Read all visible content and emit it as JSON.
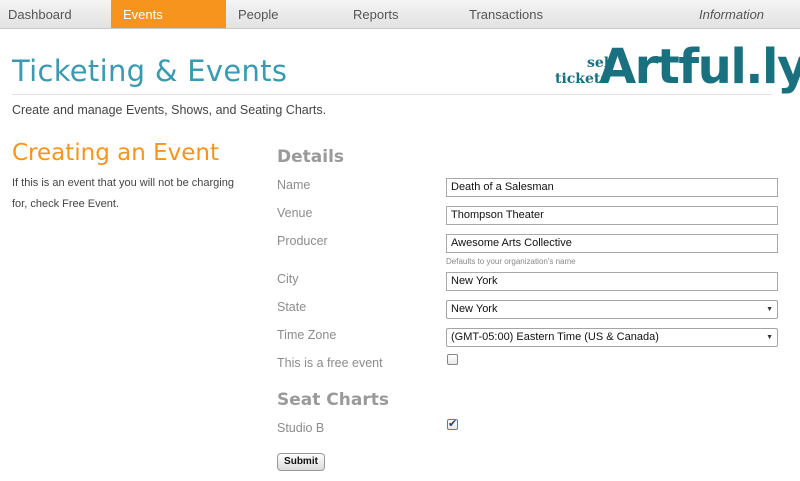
{
  "nav": {
    "items": [
      {
        "label": "Dashboard"
      },
      {
        "label": "Events"
      },
      {
        "label": "People"
      },
      {
        "label": "Reports"
      },
      {
        "label": "Transactions"
      },
      {
        "label": "Information"
      }
    ],
    "active_color": "#f7941d"
  },
  "header": {
    "title": "Ticketing & Events",
    "subtitle": "Create and manage Events, Shows, and Seating Charts."
  },
  "logo": {
    "line1": "sell",
    "line2": "tickets",
    "brand": "Artful.ly",
    "color": "#19707f"
  },
  "left": {
    "heading": "Creating an Event",
    "help": "If this is an event that you will not be charging for, check Free Event."
  },
  "form": {
    "heading": "Details",
    "name_label": "Name",
    "name_value": "Death of a Salesman",
    "venue_label": "Venue",
    "venue_value": "Thompson Theater",
    "producer_label": "Producer",
    "producer_value": "Awesome Arts Collective",
    "producer_hint": "Defaults to your organization's name",
    "city_label": "City",
    "city_value": "New York",
    "state_label": "State",
    "state_value": "New York",
    "timezone_label": "Time Zone",
    "timezone_value": "(GMT-05:00) Eastern Time (US & Canada)",
    "free_label": "This is a free event",
    "free_checked": false
  },
  "seat_charts": {
    "heading": "Seat Charts",
    "items": [
      {
        "label": "Studio B",
        "checked": true
      }
    ]
  },
  "submit_label": "Submit",
  "colors": {
    "title": "#3a9bb0",
    "accent": "#f7941d"
  }
}
